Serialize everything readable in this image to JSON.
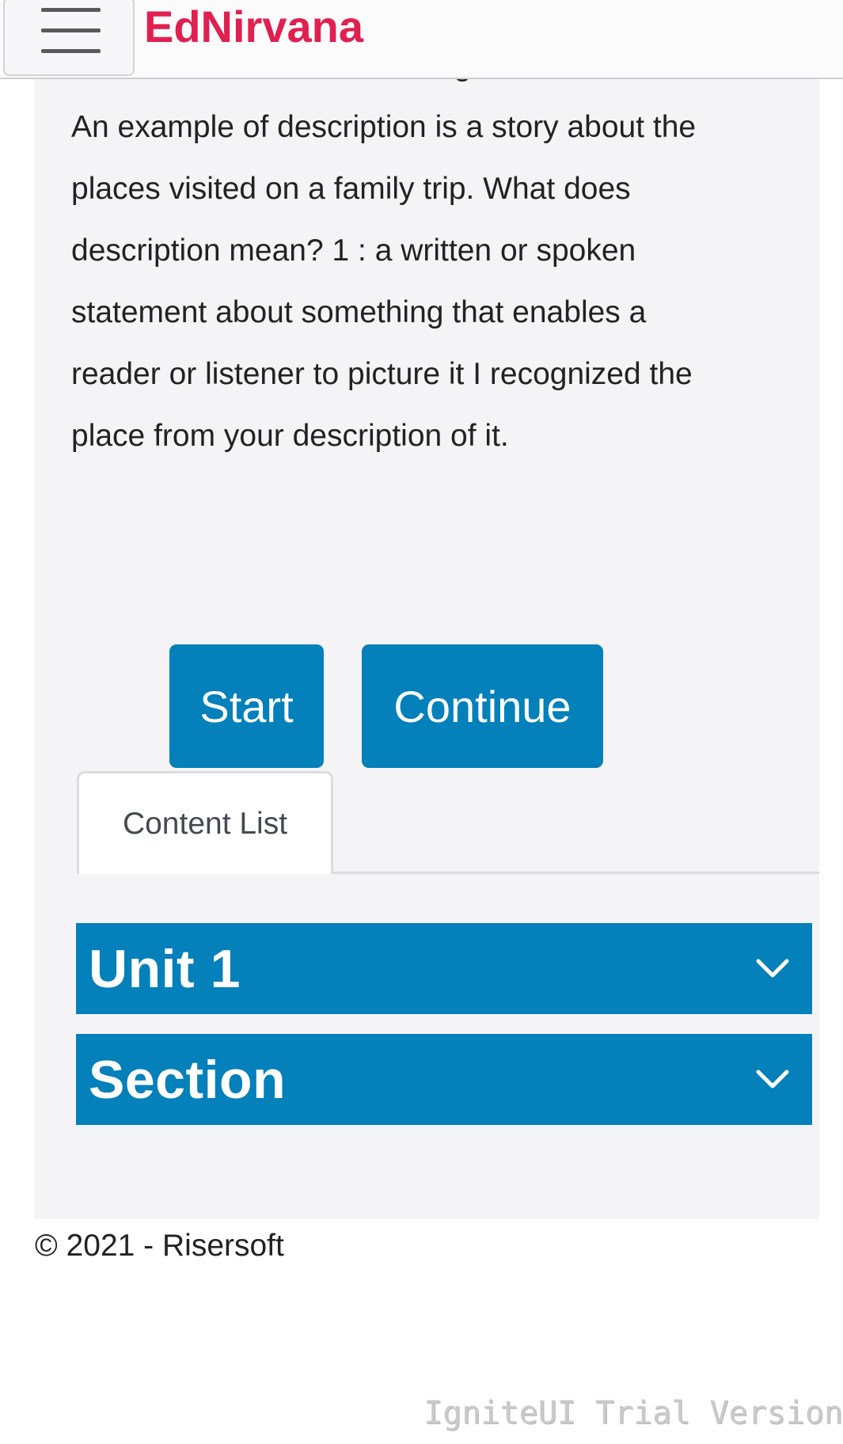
{
  "header": {
    "brand": "EdNirvana",
    "menu_icon": "hamburger-menu-icon",
    "brand_color": "#e0204f"
  },
  "main": {
    "description_lines": [
      "about someone or something.",
      "An example of description is a story about the",
      "places visited on a family trip. What does",
      "description mean? 1 : a written or spoken",
      "statement about something that enables a",
      "reader or listener to picture it I recognized the",
      "place from your description of it."
    ],
    "buttons": {
      "start_label": "Start",
      "continue_label": "Continue"
    },
    "tabs": [
      {
        "label": "Content List",
        "active": true
      }
    ],
    "accordion": [
      {
        "title": "Unit 1",
        "icon": "chevron-down-icon"
      },
      {
        "title": "Section",
        "icon": "chevron-down-icon"
      }
    ],
    "accent_color": "#0480ba"
  },
  "footer": {
    "copyright": "© 2021 - Risersoft"
  },
  "watermark": {
    "text": "IgniteUI Trial Version"
  }
}
